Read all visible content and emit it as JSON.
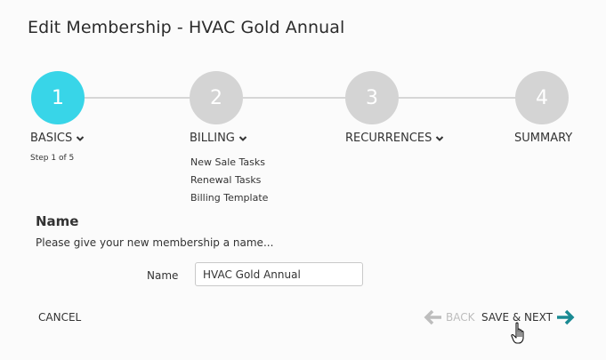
{
  "page": {
    "title": "Edit Membership - HVAC Gold Annual"
  },
  "steps": [
    {
      "number": "1",
      "label": "BASICS",
      "sub": "Step 1 of 5",
      "active": true
    },
    {
      "number": "2",
      "label": "BILLING",
      "subitems": [
        "New Sale Tasks",
        "Renewal Tasks",
        "Billing Template"
      ]
    },
    {
      "number": "3",
      "label": "RECURRENCES"
    },
    {
      "number": "4",
      "label": "SUMMARY"
    }
  ],
  "section": {
    "title": "Name",
    "description": "Please give your new membership a name..."
  },
  "form": {
    "name_label": "Name",
    "name_value": "HVAC Gold Annual"
  },
  "footer": {
    "cancel": "CANCEL",
    "back": "BACK",
    "next": "SAVE & NEXT"
  },
  "colors": {
    "active_step": "#38d5e8",
    "inactive_step": "#d4d4d4",
    "next_arrow": "#1a8a93",
    "back_arrow": "#bdbdbd"
  },
  "icons": {
    "chevron": "chevron-down-icon",
    "back": "arrow-left-icon",
    "next": "arrow-right-icon",
    "cursor": "hand-pointer-icon"
  }
}
